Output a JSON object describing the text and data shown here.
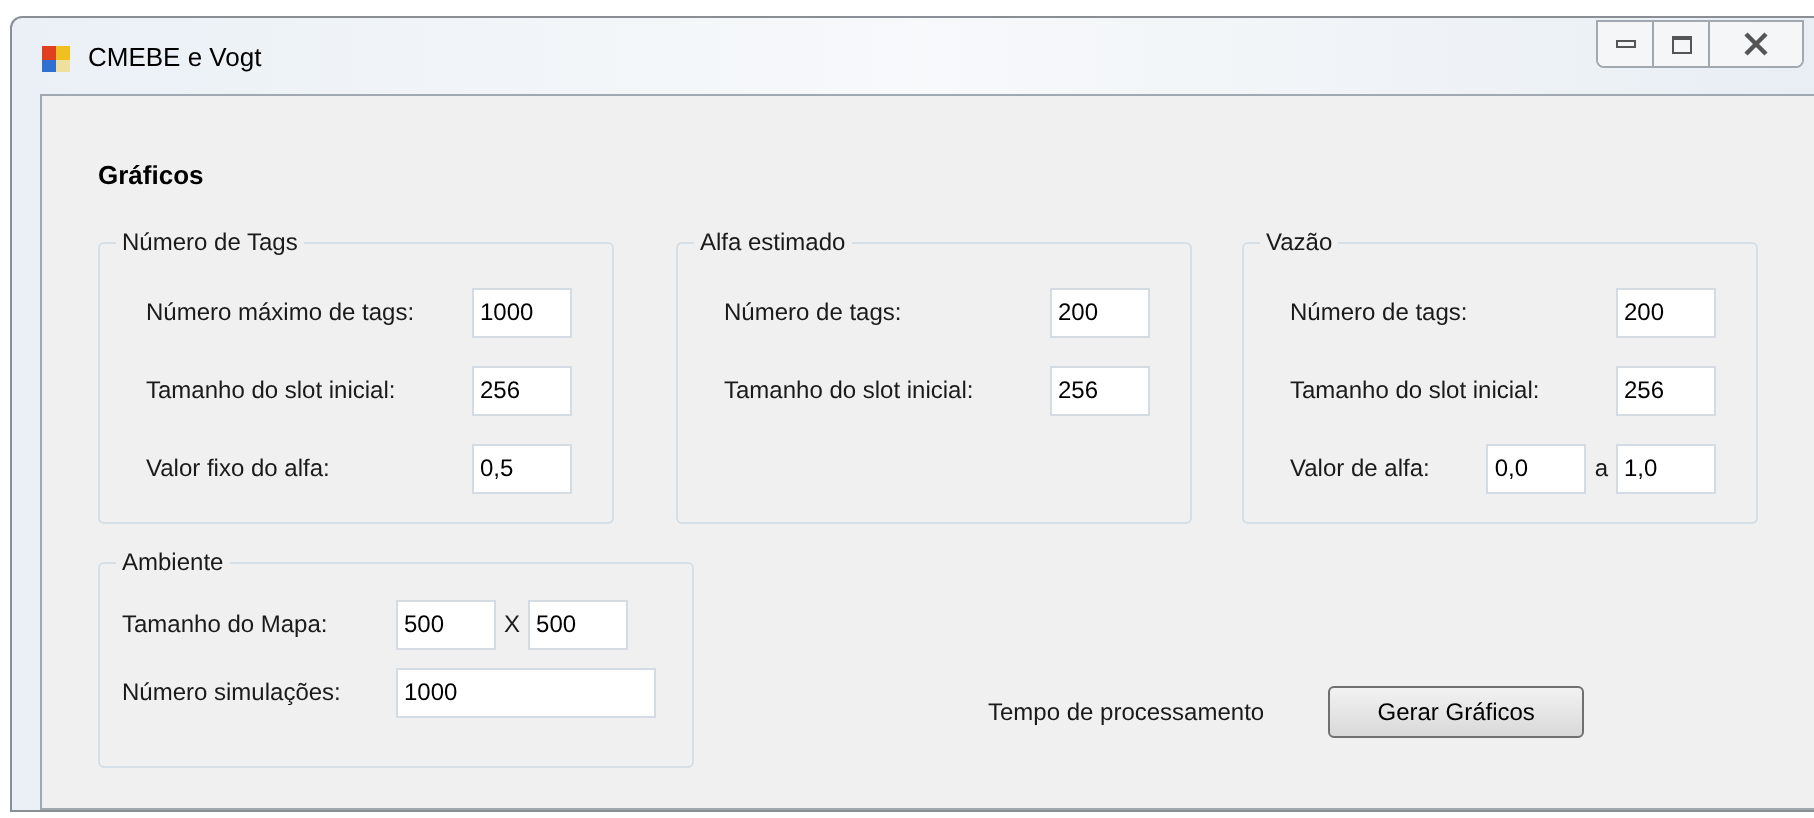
{
  "window": {
    "title": "CMEBE e Vogt"
  },
  "heading": "Gráficos",
  "groups": [
    {
      "title": "Número de Tags",
      "rows": [
        {
          "items": [
            {
              "kind": "label",
              "text": "Número máximo de tags:"
            },
            {
              "kind": "field",
              "value": "1000"
            }
          ]
        },
        {
          "items": [
            {
              "kind": "label",
              "text": "Tamanho do slot inicial:"
            },
            {
              "kind": "field",
              "value": "256"
            }
          ]
        },
        {
          "items": [
            {
              "kind": "label",
              "text": "Valor fixo do alfa:"
            },
            {
              "kind": "field",
              "value": "0,5"
            }
          ]
        }
      ]
    },
    {
      "title": "Alfa estimado",
      "rows": [
        {
          "items": [
            {
              "kind": "label",
              "text": "Número de tags:"
            },
            {
              "kind": "field",
              "value": "200"
            }
          ]
        },
        {
          "items": [
            {
              "kind": "label",
              "text": "Tamanho do slot inicial:"
            },
            {
              "kind": "field",
              "value": "256"
            }
          ]
        }
      ]
    },
    {
      "title": "Vazão",
      "rows": [
        {
          "items": [
            {
              "kind": "label",
              "text": "Número de tags:"
            },
            {
              "kind": "field",
              "value": "200"
            }
          ]
        },
        {
          "items": [
            {
              "kind": "label",
              "text": "Tamanho do slot inicial:"
            },
            {
              "kind": "field",
              "value": "256"
            }
          ]
        },
        {
          "items": [
            {
              "kind": "label",
              "text": "Valor de alfa:"
            },
            {
              "kind": "field",
              "value": "0,0"
            },
            {
              "kind": "sep",
              "text": "a"
            },
            {
              "kind": "field",
              "value": "1,0"
            }
          ]
        }
      ]
    }
  ],
  "ambiente": {
    "title": "Ambiente",
    "rows": [
      {
        "items": [
          {
            "kind": "label",
            "text": "Tamanho do Mapa:"
          },
          {
            "kind": "field",
            "value": "500"
          },
          {
            "kind": "sep",
            "text": "X"
          },
          {
            "kind": "field",
            "value": "500"
          }
        ]
      },
      {
        "items": [
          {
            "kind": "label",
            "text": "Número simulações:"
          },
          {
            "kind": "wide",
            "value": "1000"
          }
        ]
      }
    ]
  },
  "status_label": "Tempo de processamento",
  "button": "Gerar Gráficos"
}
